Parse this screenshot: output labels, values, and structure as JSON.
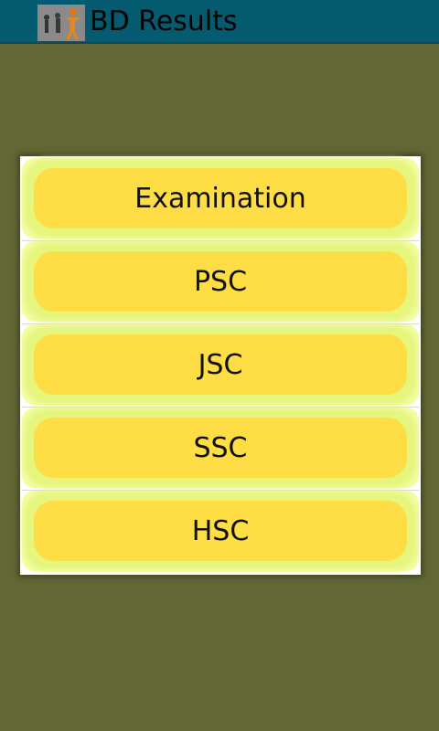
{
  "app": {
    "title": "BD Results",
    "icon": "app-logo-icon"
  },
  "menu": {
    "items": [
      {
        "label": "Examination"
      },
      {
        "label": "PSC"
      },
      {
        "label": "JSC"
      },
      {
        "label": "SSC"
      },
      {
        "label": "HSC"
      }
    ]
  },
  "colors": {
    "title_bar": "#045a6e",
    "background": "#626834",
    "button": "#ffdd44",
    "button_glow": "#e6f57c"
  }
}
